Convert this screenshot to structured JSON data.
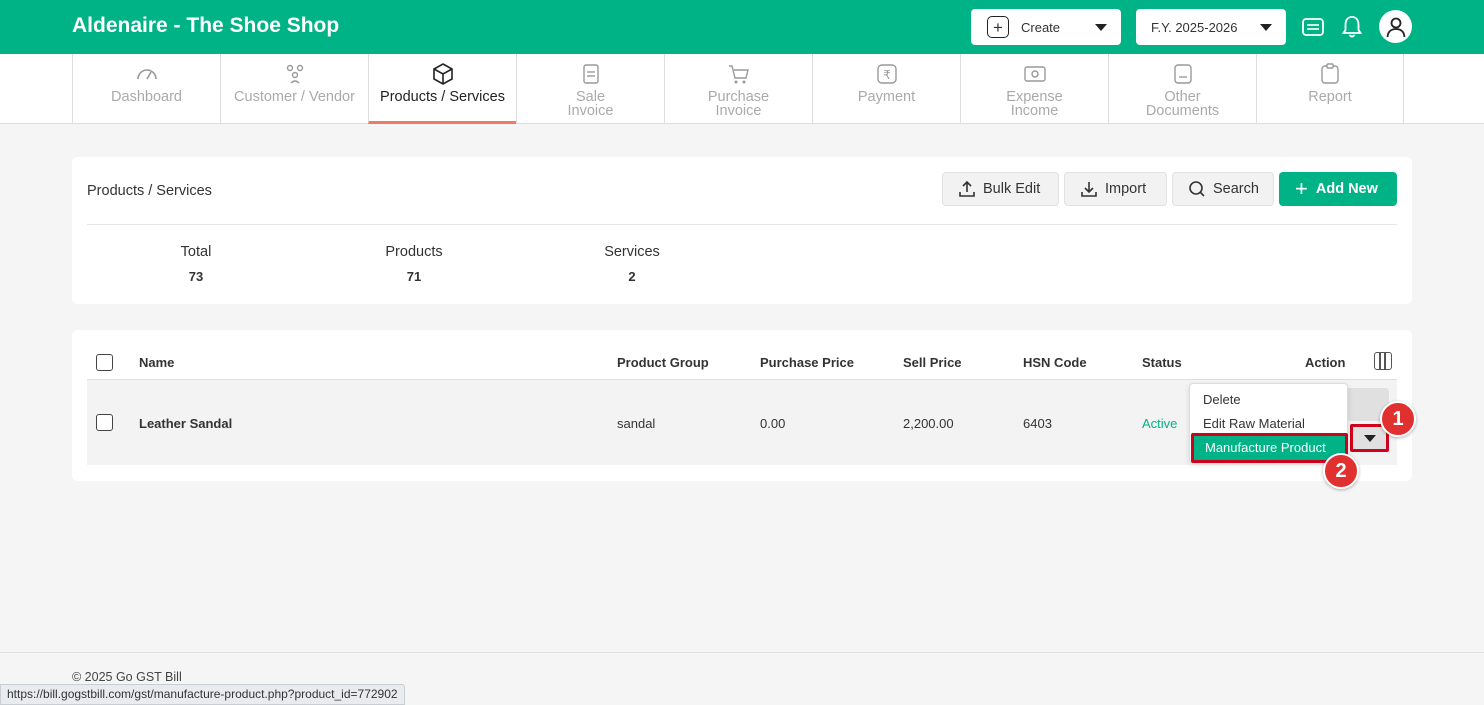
{
  "header": {
    "brand": "Aldenaire - The Shoe Shop",
    "create_label": "Create",
    "fy_label": "F.Y. 2025-2026",
    "brand_color": "#00b386"
  },
  "nav": {
    "tabs": [
      {
        "line1": "Dashboard",
        "line2": "",
        "icon": "speedometer-icon"
      },
      {
        "line1": "Customer / Vendor",
        "line2": "",
        "icon": "users-icon"
      },
      {
        "line1": "Products / Services",
        "line2": "",
        "icon": "box-icon",
        "active": true
      },
      {
        "line1": "Sale",
        "line2": "Invoice",
        "icon": "receipt-icon"
      },
      {
        "line1": "Purchase",
        "line2": "Invoice",
        "icon": "cart-icon"
      },
      {
        "line1": "Payment",
        "line2": "",
        "icon": "rupee-icon"
      },
      {
        "line1": "Expense",
        "line2": "Income",
        "icon": "money-icon"
      },
      {
        "line1": "Other",
        "line2": "Documents",
        "icon": "document-icon"
      },
      {
        "line1": "Report",
        "line2": "",
        "icon": "clipboard-icon"
      }
    ]
  },
  "summary": {
    "title": "Products / Services",
    "bulk_edit": "Bulk Edit",
    "import": "Import",
    "search": "Search",
    "add_new": "Add New",
    "stats": [
      {
        "label": "Total",
        "value": "73"
      },
      {
        "label": "Products",
        "value": "71"
      },
      {
        "label": "Services",
        "value": "2"
      }
    ]
  },
  "table": {
    "columns": [
      "Name",
      "Product Group",
      "Purchase Price",
      "Sell Price",
      "HSN Code",
      "Status",
      "Action"
    ],
    "rows": [
      {
        "name": "Leather Sandal",
        "group": "sandal",
        "purchase_price": "0.00",
        "sell_price": "2,200.00",
        "hsn": "6403",
        "status": "Active"
      }
    ]
  },
  "action_menu": {
    "items": [
      "Delete",
      "Edit Raw Material",
      "Manufacture Product"
    ],
    "highlighted": "Manufacture Product"
  },
  "badges": [
    "1",
    "2"
  ],
  "footer": {
    "copyright": "© 2025 Go GST Bill",
    "status_url": "https://bill.gogstbill.com/gst/manufacture-product.php?product_id=772902"
  }
}
